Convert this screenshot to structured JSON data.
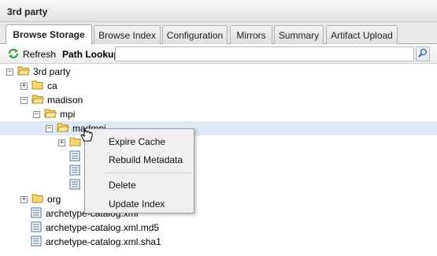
{
  "panel": {
    "title": "3rd party"
  },
  "tabs": [
    {
      "label": "Browse Storage",
      "active": true
    },
    {
      "label": "Browse Index",
      "active": false
    },
    {
      "label": "Configuration",
      "active": false
    },
    {
      "label": "Mirrors",
      "active": false
    },
    {
      "label": "Summary",
      "active": false
    },
    {
      "label": "Artifact Upload",
      "active": false
    }
  ],
  "toolbar": {
    "refresh_label": "Refresh",
    "path_label": "Path Lookup:",
    "path_value": ""
  },
  "tree": {
    "root": "3rd party",
    "ca": "ca",
    "madison": "madison",
    "mpi": "mpi",
    "selected": "madmpi",
    "org": "org",
    "file1": "archetype-catalog.xml",
    "file2": "archetype-catalog.xml.md5",
    "file3": "archetype-catalog.xml.sha1"
  },
  "context_menu": {
    "items": [
      "Expire Cache",
      "Rebuild Metadata",
      "Delete",
      "Update Index"
    ]
  },
  "colors": {
    "selection": "#dfe8f6",
    "folder": "#f5d76e",
    "refresh": "#3d9a3d"
  }
}
